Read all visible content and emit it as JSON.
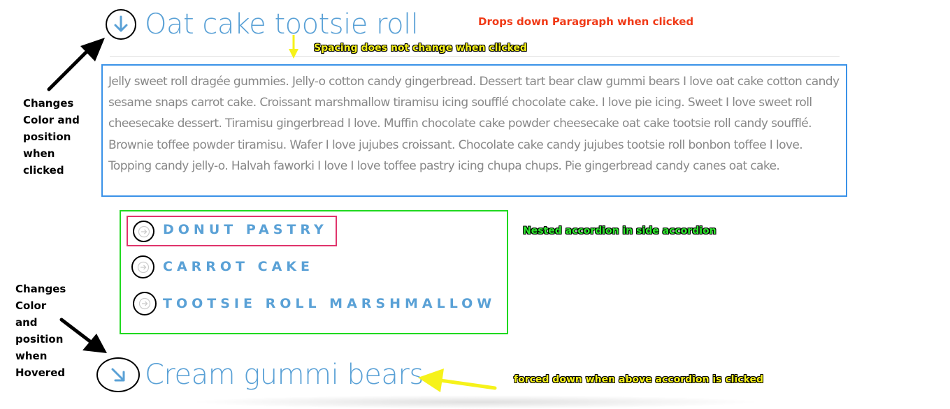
{
  "accordion": {
    "first": {
      "title": "Oat cake tootsie roll",
      "icon": "arrow-down-circle-icon",
      "paragraph": "Jelly sweet roll dragée gummies. Jelly-o cotton candy gingerbread. Dessert tart bear claw gummi bears I love oat cake cotton candy sesame snaps carrot cake. Croissant marshmallow tiramisu icing soufflé chocolate cake. I love pie icing. Sweet I love sweet roll cheesecake dessert. Tiramisu gingerbread I love. Muffin chocolate cake powder cheesecake oat cake tootsie roll candy soufflé. Brownie toffee powder tiramisu. Wafer I love jujubes croissant. Chocolate cake candy jujubes tootsie roll bonbon toffee I love. Topping candy jelly-o. Halvah faworki I love I love toffee pastry icing chupa chups. Pie gingerbread candy canes oat cake."
    },
    "nested": [
      {
        "label": "DONUT PASTRY",
        "icon": "arrow-right-circle-icon"
      },
      {
        "label": "CARROT CAKE",
        "icon": "arrow-right-circle-icon"
      },
      {
        "label": "TOOTSIE ROLL MARSHMALLOW",
        "icon": "arrow-right-circle-icon"
      }
    ],
    "second": {
      "title": "Cream gummi bears",
      "icon": "arrow-down-right-circle-icon"
    }
  },
  "annotations": {
    "drops_down": "Drops down Paragraph when clicked",
    "spacing": "Spacing does not change when clicked",
    "nested": "Nested accordion in side accordion",
    "forced_down": "forced down when above accordion is clicked",
    "changes_clicked": [
      "Changes",
      "Color and",
      "position",
      "when",
      "clicked"
    ],
    "changes_hovered": [
      "Changes",
      "Color",
      "and",
      "position",
      "when",
      "Hovered"
    ]
  },
  "colors": {
    "title_blue": "#5aa1d6",
    "paragraph_border": "#3a92e8",
    "nested_border": "#1fd91f",
    "highlight_border": "#e0346b",
    "annotation_red": "#f03a17",
    "annotation_yellow": "#f6f21a",
    "annotation_green": "#2ee62e"
  }
}
